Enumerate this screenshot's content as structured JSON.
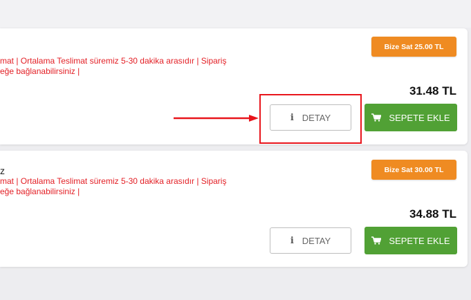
{
  "products": [
    {
      "title": "",
      "info_line1": "mat | Ortalama Teslimat süremiz 5-30 dakika arasıdır | Sipariş",
      "info_line2": "eğe bağlanabilirsiniz |",
      "sell_badge": "Bize Sat 25.00 TL",
      "price": "31.48 TL",
      "detail_button": "DETAY",
      "cart_button": "SEPETE EKLE"
    },
    {
      "title": "z",
      "info_line1": "mat | Ortalama Teslimat süremiz 5-30 dakika arasıdır | Sipariş",
      "info_line2": "eğe bağlanabilirsiniz |",
      "sell_badge": "Bize Sat 30.00 TL",
      "price": "34.88 TL",
      "detail_button": "DETAY",
      "cart_button": "SEPETE EKLE"
    }
  ],
  "icons": {
    "info": "info-icon",
    "cart": "cart-icon"
  },
  "colors": {
    "accent_orange": "#ef8b22",
    "cart_green": "#51a135",
    "info_red": "#e31e24",
    "annotation_red": "#e8141b"
  }
}
